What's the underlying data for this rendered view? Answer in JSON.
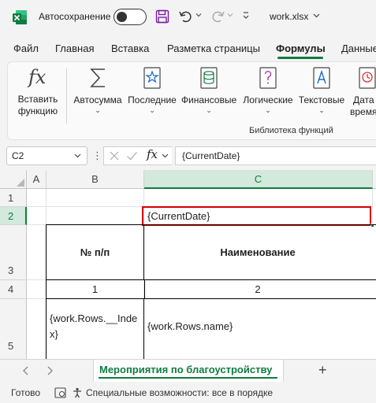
{
  "titlebar": {
    "autosave_label": "Автосохранение",
    "file_name": "work.xlsx"
  },
  "tabs": [
    "Файл",
    "Главная",
    "Вставка",
    "Разметка страницы",
    "Формулы",
    "Данные"
  ],
  "active_tab": "Формулы",
  "ribbon": {
    "buttons": [
      {
        "icon": "fx-icon",
        "label_line1": "Вставить",
        "label_line2": "функцию"
      },
      {
        "icon": "sigma-icon",
        "label": "Автосумма"
      },
      {
        "icon": "star-book-icon",
        "label": "Последние"
      },
      {
        "icon": "database-book-icon",
        "label": "Финансовые"
      },
      {
        "icon": "question-book-icon",
        "label": "Логические"
      },
      {
        "icon": "text-book-icon",
        "label": "Текстовые"
      },
      {
        "icon": "clock-book-icon",
        "label_line1": "Дата",
        "label_line2": "время"
      }
    ],
    "group_caption": "Библиотека функций"
  },
  "formula_bar": {
    "namebox": "C2",
    "fx": "fx",
    "value": "{CurrentDate}"
  },
  "grid": {
    "columns": [
      "A",
      "B",
      "C"
    ],
    "rows": [
      "1",
      "2",
      "3",
      "4",
      "5"
    ],
    "cells": {
      "C2": "{CurrentDate}",
      "B3": "№ п/п",
      "C3": "Наименование",
      "B4": "1",
      "C4": "2",
      "B5": "{work.Rows.__Index}",
      "C5": "{work.Rows.name}"
    },
    "selected_cell": "C2"
  },
  "sheets": {
    "active": "Мероприятия по благоустройству",
    "add": "+"
  },
  "statusbar": {
    "ready": "Готово",
    "accessibility": "Специальные возможности: все в порядке"
  },
  "colors": {
    "accent_green": "#107c41",
    "selection_red": "#d40000"
  }
}
